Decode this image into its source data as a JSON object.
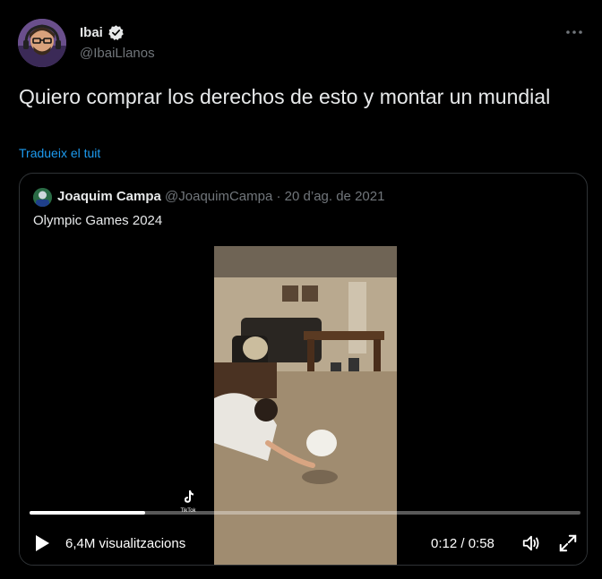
{
  "author": {
    "name": "Ibai",
    "handle": "@IbaiLlanos",
    "verified": true
  },
  "tweet": {
    "text": "Quiero comprar los derechos de esto y montar un mundial",
    "translate_label": "Tradueix el tuit"
  },
  "quoted": {
    "name": "Joaquim Campa",
    "handle": "@JoaquimCampa",
    "separator": "·",
    "date": "20 d’ag. de 2021",
    "text": "Olympic Games 2024",
    "video": {
      "views": "6,4M visualitzacions",
      "time": "0:12 / 0:58",
      "progress": 0.21,
      "watermark": "TikTok"
    }
  },
  "colors": {
    "background": "#000000",
    "text": "#e7e9ea",
    "secondary": "#71767b",
    "link": "#1d9bf0",
    "border": "#2f3336"
  },
  "icons": [
    "verified-badge-icon",
    "more-icon",
    "play-icon",
    "volume-icon",
    "fullscreen-icon",
    "tiktok-icon"
  ]
}
